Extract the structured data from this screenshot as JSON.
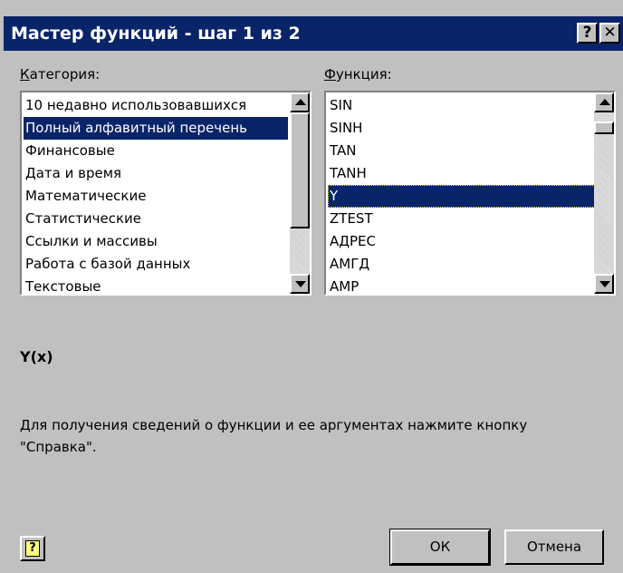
{
  "window": {
    "title": "Мастер функций - шаг 1 из 2",
    "help_glyph": "?",
    "close_glyph": "✕"
  },
  "category": {
    "label_accel": "К",
    "label_rest": "атегория:",
    "items": [
      "10 недавно использовавшихся",
      "Полный алфавитный перечень",
      "Финансовые",
      "Дата и время",
      "Математические",
      "Статистические",
      "Ссылки и массивы",
      "Работа с базой данных",
      "Текстовые"
    ],
    "selected_index": 1
  },
  "function": {
    "label_accel": "Ф",
    "label_rest": "ункция:",
    "items": [
      "SIN",
      "SINH",
      "TAN",
      "TANH",
      "Y",
      "ZTEST",
      "АДРЕС",
      "АМГД",
      "АМР"
    ],
    "selected_index": 4
  },
  "signature": "Y(x)",
  "description": "Для получения сведений о функции и ее аргументах нажмите кнопку \"Справка\".",
  "buttons": {
    "ok": "ОК",
    "cancel": "Отмена"
  },
  "colors": {
    "titlebar": "#0a246a",
    "dialog_face": "#c0c0c0",
    "selection": "#0a246a"
  }
}
